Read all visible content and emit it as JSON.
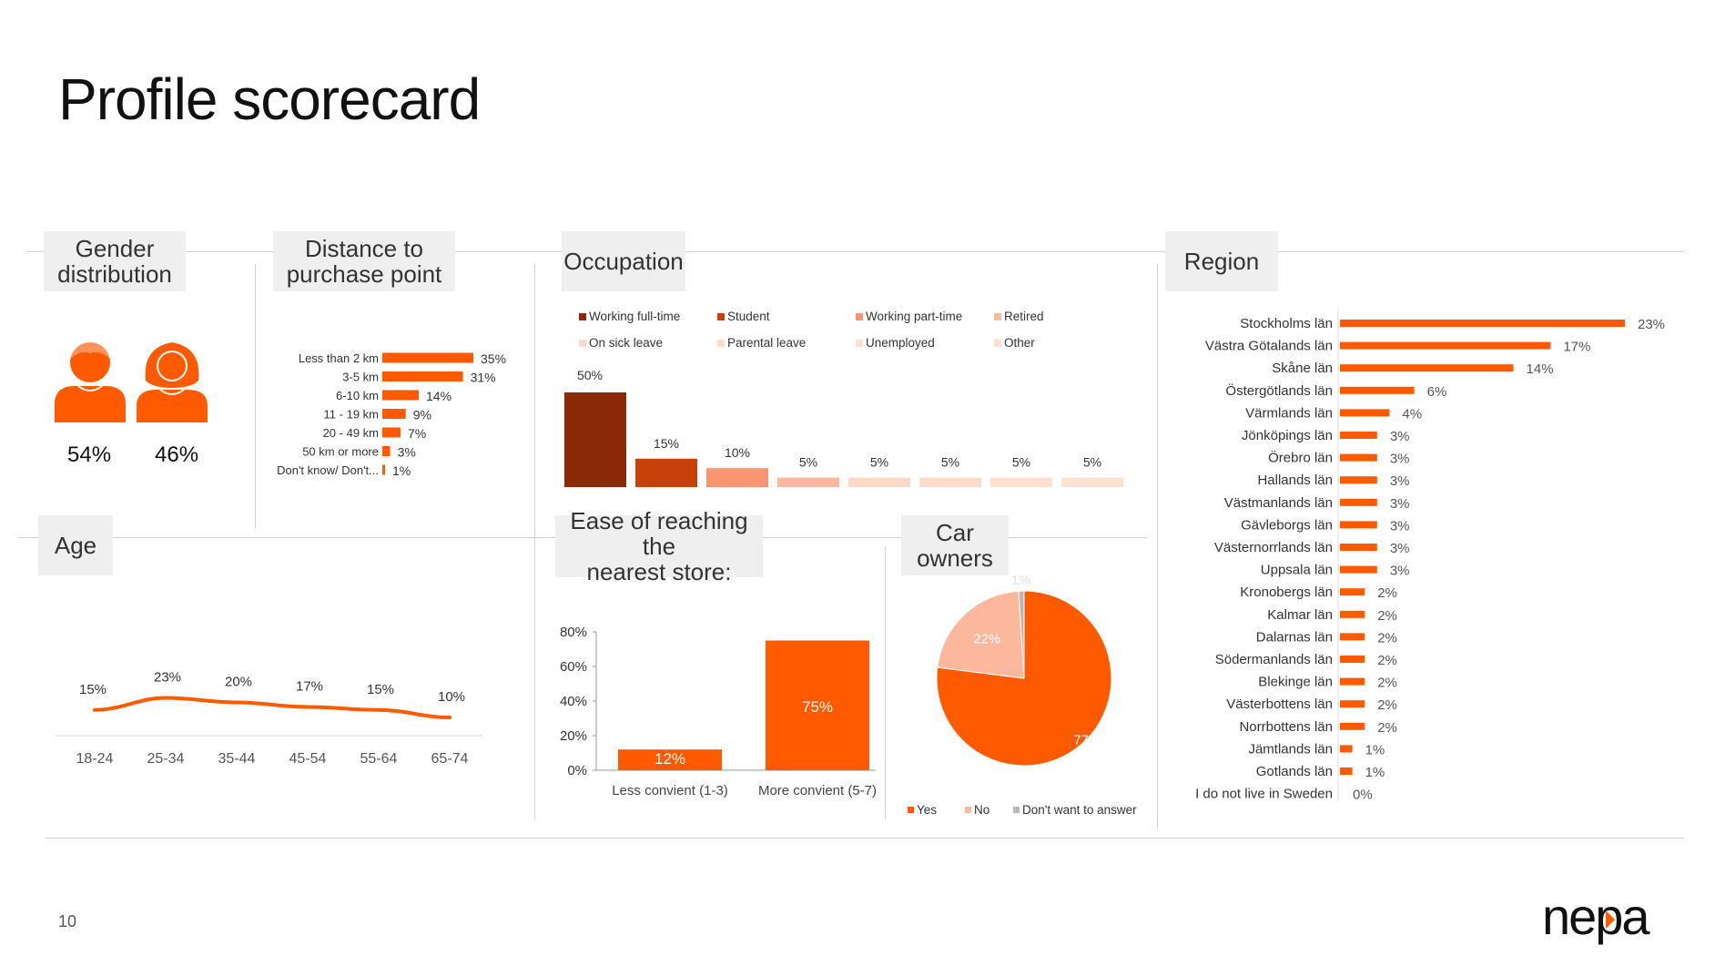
{
  "page": {
    "title": "Profile scorecard",
    "page_number": "10",
    "logo": "nepa",
    "accent_color": "#ff5a00",
    "icons": [
      "male-person-icon",
      "female-person-icon"
    ]
  },
  "headers": {
    "gender": [
      "Gender",
      "distribution"
    ],
    "distance": [
      "Distance to",
      "purchase point"
    ],
    "occupation": "Occupation",
    "region": "Region",
    "age": "Age",
    "ease": [
      "Ease of reaching the",
      "nearest store:"
    ],
    "car": [
      "Car",
      "owners"
    ]
  },
  "gender": {
    "male": "54%",
    "female": "46%"
  },
  "chart_data": [
    {
      "id": "distance",
      "type": "bar",
      "orientation": "horizontal",
      "categories": [
        "Less than 2 km",
        "3-5 km",
        "6-10 km",
        "11 - 19 km",
        "20 - 49 km",
        "50 km or more",
        "Don't know/ Don't..."
      ],
      "values": [
        35,
        31,
        14,
        9,
        7,
        3,
        1
      ],
      "labels": [
        "35%",
        "31%",
        "14%",
        "9%",
        "7%",
        "3%",
        "1%"
      ],
      "color": "#ff5a00"
    },
    {
      "id": "occupation",
      "type": "bar",
      "series": [
        {
          "name": "Working full-time",
          "value": 50,
          "label": "50%",
          "color": "#8b2a08"
        },
        {
          "name": "Student",
          "value": 15,
          "label": "15%",
          "color": "#c8410a"
        },
        {
          "name": "Working part-time",
          "value": 10,
          "label": "10%",
          "color": "#f99570"
        },
        {
          "name": "Retired",
          "value": 5,
          "label": "5%",
          "color": "#fbb89c"
        },
        {
          "name": "On sick leave",
          "value": 5,
          "label": "5%",
          "color": "#fcd9c8"
        },
        {
          "name": "Parental leave",
          "value": 5,
          "label": "5%",
          "color": "#fcdccc"
        },
        {
          "name": "Unemployed",
          "value": 5,
          "label": "5%",
          "color": "#fde0d0"
        },
        {
          "name": "Other",
          "value": 5,
          "label": "5%",
          "color": "#fde3d4"
        }
      ]
    },
    {
      "id": "region",
      "type": "bar",
      "orientation": "horizontal",
      "categories": [
        "Stockholms län",
        "Västra Götalands län",
        "Skåne län",
        "Östergötlands län",
        "Värmlands län",
        "Jönköpings län",
        "Örebro län",
        "Hallands län",
        "Västmanlands län",
        "Gävleborgs län",
        "Västernorrlands län",
        "Uppsala län",
        "Kronobergs län",
        "Kalmar län",
        "Dalarnas län",
        "Södermanlands län",
        "Blekinge län",
        "Västerbottens län",
        "Norrbottens län",
        "Jämtlands län",
        "Gotlands län",
        "I do not live in Sweden"
      ],
      "values": [
        23,
        17,
        14,
        6,
        4,
        3,
        3,
        3,
        3,
        3,
        3,
        3,
        2,
        2,
        2,
        2,
        2,
        2,
        2,
        1,
        1,
        0
      ],
      "labels": [
        "23%",
        "17%",
        "14%",
        "6%",
        "4%",
        "3%",
        "3%",
        "3%",
        "3%",
        "3%",
        "3%",
        "3%",
        "2%",
        "2%",
        "2%",
        "2%",
        "2%",
        "2%",
        "2%",
        "1%",
        "1%",
        "0%"
      ],
      "color": "#ff5a00"
    },
    {
      "id": "age",
      "type": "line",
      "categories": [
        "18-24",
        "25-34",
        "35-44",
        "45-54",
        "55-64",
        "65-74"
      ],
      "values": [
        15,
        23,
        20,
        17,
        15,
        10
      ],
      "labels": [
        "15%",
        "23%",
        "20%",
        "17%",
        "15%",
        "10%"
      ],
      "color": "#ff5a00"
    },
    {
      "id": "ease",
      "type": "bar",
      "categories": [
        "Less convient (1-3)",
        "More convient (5-7)"
      ],
      "values": [
        12,
        75
      ],
      "labels": [
        "12%",
        "75%"
      ],
      "yticks": [
        "0%",
        "20%",
        "40%",
        "60%",
        "80%"
      ],
      "ylim": [
        0,
        80
      ],
      "color": "#ff5a00"
    },
    {
      "id": "car",
      "type": "pie",
      "slices": [
        {
          "name": "Yes",
          "value": 77,
          "label": "77%",
          "color": "#ff5a00"
        },
        {
          "name": "No",
          "value": 22,
          "label": "22%",
          "color": "#fbb89c"
        },
        {
          "name": "Don't want to answer",
          "value": 1,
          "label": "1%",
          "color": "#b8b8b8"
        }
      ]
    }
  ]
}
